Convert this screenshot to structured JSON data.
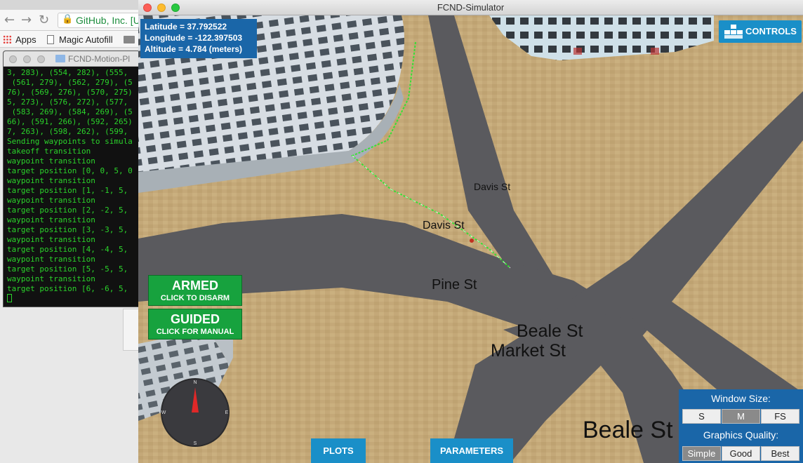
{
  "browser": {
    "url_text": "GitHub, Inc. [U",
    "bookmarks": {
      "apps": "Apps",
      "magic_autofill": "Magic Autofill"
    }
  },
  "terminal": {
    "title": "FCND-Motion-Pl",
    "lines": [
      "3, 283), (554, 282), (555,",
      " (561, 279), (562, 279), (5",
      "76), (569, 276), (570, 275)",
      "5, 273), (576, 272), (577,",
      " (583, 269), (584, 269), (5",
      "66), (591, 266), (592, 265)",
      "7, 263), (598, 262), (599,",
      "Sending waypoints to simula",
      "takeoff transition",
      "waypoint transition",
      "target position [0, 0, 5, 0",
      "waypoint transition",
      "target position [1, -1, 5,",
      "waypoint transition",
      "target position [2, -2, 5,",
      "waypoint transition",
      "target position [3, -3, 5,",
      "waypoint transition",
      "target position [4, -4, 5,",
      "waypoint transition",
      "target position [5, -5, 5,",
      "waypoint transition",
      "target position [6, -6, 5,"
    ]
  },
  "simulator": {
    "window_title": "FCND-Simulator",
    "readout": {
      "latitude": "Latitude = 37.792522",
      "longitude": "Longitude = -122.397503",
      "altitude": "Altitude = 4.784 (meters)"
    },
    "controls_label": "CONTROLS",
    "armed": {
      "title": "ARMED",
      "subtitle": "CLICK TO DISARM"
    },
    "guided": {
      "title": "GUIDED",
      "subtitle": "CLICK FOR MANUAL"
    },
    "plots_label": "PLOTS",
    "parameters_label": "PARAMETERS",
    "window_size": {
      "heading": "Window Size:",
      "options": [
        "S",
        "M",
        "FS"
      ],
      "selected": "M"
    },
    "graphics_quality": {
      "heading": "Graphics Quality:",
      "options": [
        "Simple",
        "Good",
        "Best"
      ],
      "selected": "Simple"
    },
    "compass": {
      "n": "N",
      "s": "S",
      "e": "E",
      "w": "W"
    },
    "streets": {
      "davis_top": "Davis St",
      "davis_mid": "Davis St",
      "pine": "Pine St",
      "beale_mid": "Beale St",
      "market": "Market St",
      "beale_bottom": "Beale St"
    },
    "colors": {
      "ground": "#c4a878",
      "road": "#5a5a5e",
      "panel_blue": "#1a66a8",
      "button_blue": "#1a8fc8",
      "button_green": "#17a23e"
    }
  }
}
